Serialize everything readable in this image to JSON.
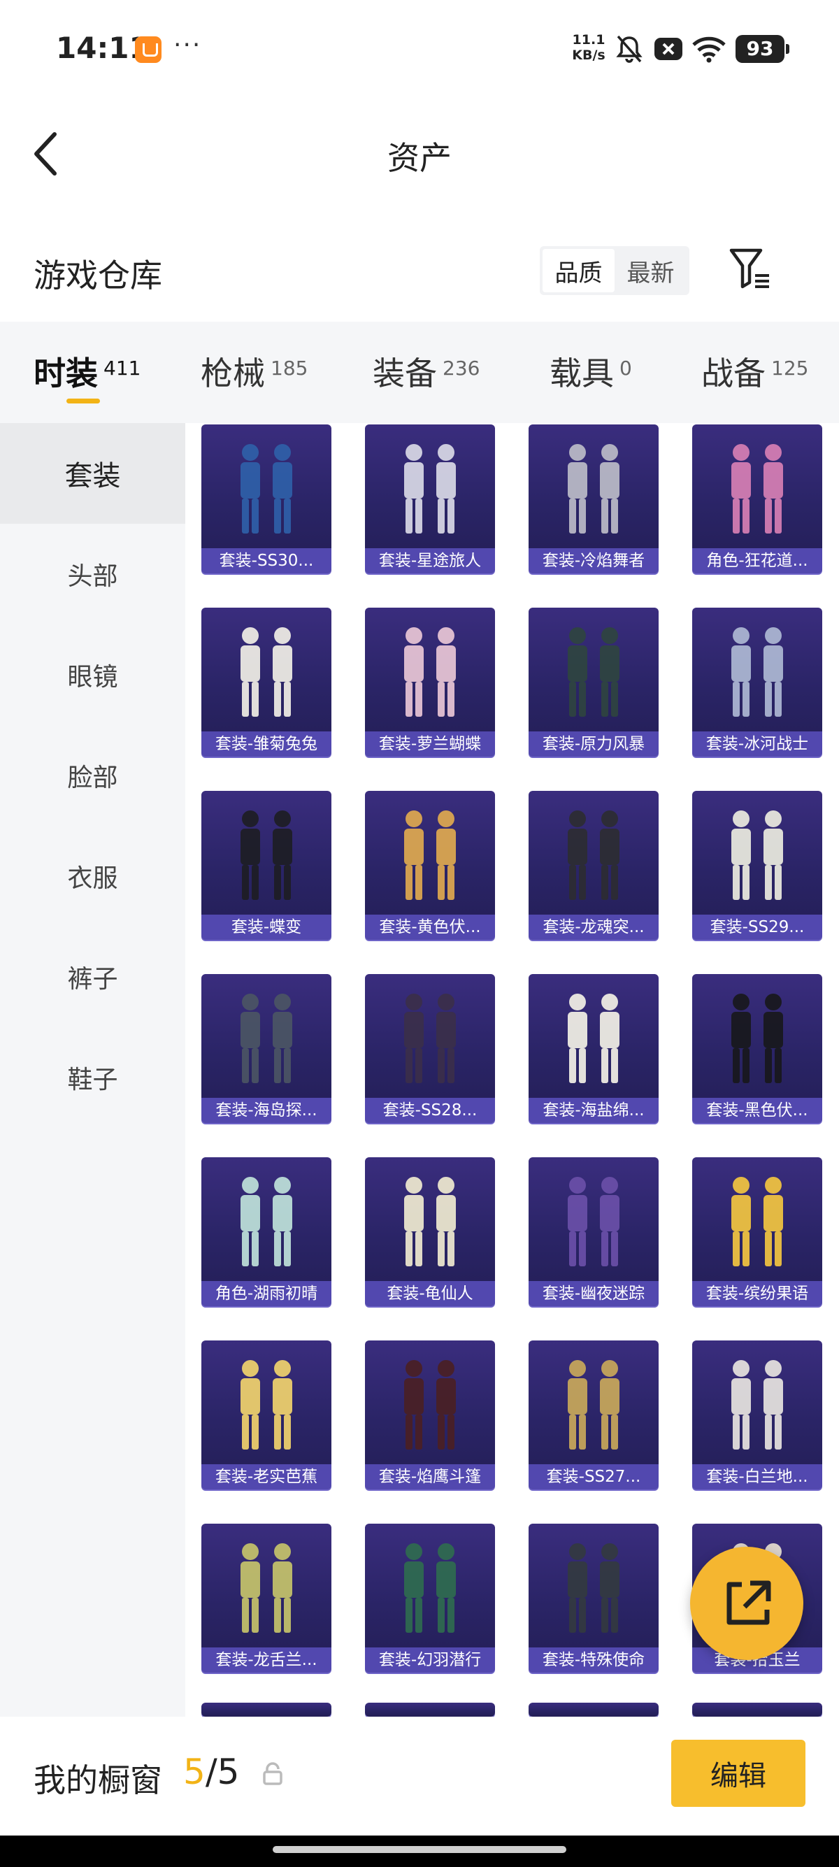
{
  "status_bar": {
    "time": "14:11",
    "dots": "···",
    "net_speed_value": "11.1",
    "net_speed_unit": "KB/s",
    "battery": "93",
    "icons": [
      "app-notification-icon",
      "mute-bell-icon",
      "close-badge-icon",
      "wifi-icon",
      "battery-icon"
    ]
  },
  "nav": {
    "title": "资产"
  },
  "warehouse": {
    "title": "游戏仓库",
    "sort_options": [
      "品质",
      "最新"
    ],
    "active_sort": "品质"
  },
  "tabs": [
    {
      "label": "时装",
      "count": "411"
    },
    {
      "label": "枪械",
      "count": "185"
    },
    {
      "label": "装备",
      "count": "236"
    },
    {
      "label": "载具",
      "count": "0"
    },
    {
      "label": "战备",
      "count": "125"
    }
  ],
  "sidebar": {
    "items": [
      "套装",
      "头部",
      "眼镜",
      "脸部",
      "衣服",
      "裤子",
      "鞋子"
    ]
  },
  "items": [
    {
      "name": "套装-SS30...",
      "accent": "#2f5fa8"
    },
    {
      "name": "套装-星途旅人",
      "accent": "#d9d9e6"
    },
    {
      "name": "套装-冷焰舞者",
      "accent": "#bcbcc8"
    },
    {
      "name": "角色-狂花道...",
      "accent": "#d77fb4"
    },
    {
      "name": "套装-雏菊兔兔",
      "accent": "#f1efe6"
    },
    {
      "name": "套装-萝兰蝴蝶",
      "accent": "#e9c7d6"
    },
    {
      "name": "套装-原力风暴",
      "accent": "#2f4440"
    },
    {
      "name": "套装-冰河战士",
      "accent": "#aeb9d4"
    },
    {
      "name": "套装-蝶变",
      "accent": "#1d1d24"
    },
    {
      "name": "套装-黄色伏...",
      "accent": "#e0a94f"
    },
    {
      "name": "套装-龙魂突...",
      "accent": "#2c2c32"
    },
    {
      "name": "套装-SS29...",
      "accent": "#ecebe0"
    },
    {
      "name": "套装-海岛探...",
      "accent": "#4b5564"
    },
    {
      "name": "套装-SS28...",
      "accent": "#3b2f4a"
    },
    {
      "name": "套装-海盐绵...",
      "accent": "#f3f1e6"
    },
    {
      "name": "套装-黑色伏...",
      "accent": "#18181c"
    },
    {
      "name": "角色-湖雨初晴",
      "accent": "#bfe2da"
    },
    {
      "name": "套装-龟仙人",
      "accent": "#f0ead0"
    },
    {
      "name": "套装-幽夜迷踪",
      "accent": "#6a4fa8"
    },
    {
      "name": "套装-缤纷果语",
      "accent": "#f3c640"
    },
    {
      "name": "套装-老实芭蕉",
      "accent": "#f1d36d"
    },
    {
      "name": "套装-焰鹰斗篷",
      "accent": "#4a1f24"
    },
    {
      "name": "套装-SS27...",
      "accent": "#c9a85a"
    },
    {
      "name": "套装-白兰地...",
      "accent": "#e7e4e0"
    },
    {
      "name": "套装-龙舌兰...",
      "accent": "#c5c36a"
    },
    {
      "name": "套装-幻羽潜行",
      "accent": "#2f6b4f"
    },
    {
      "name": "套装-特殊使命",
      "accent": "#333a40"
    },
    {
      "name": "套装-拾玉兰",
      "accent": "#e7e0d0"
    }
  ],
  "bottom": {
    "label": "我的橱窗",
    "current": "5",
    "separator": "/",
    "total": "5",
    "edit_label": "编辑"
  },
  "colors": {
    "accent_yellow": "#f2b316",
    "card_bg": "#2a2466",
    "card_label_bg": "#5a50be"
  }
}
